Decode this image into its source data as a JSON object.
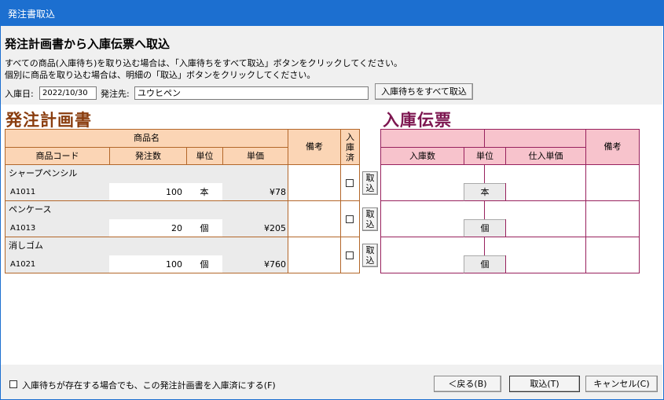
{
  "window": {
    "title": "発注書取込"
  },
  "heading": "発注計画書から入庫伝票へ取込",
  "instructions": [
    "すべての商品(入庫待ち)を取り込む場合は、「入庫待ちをすべて取込」ボタンをクリックしてください。",
    "個別に商品を取り込む場合は、明細の「取込」ボタンをクリックしてください。"
  ],
  "form": {
    "date_label": "入庫日:",
    "date_value": "2022/10/30",
    "supplier_label": "発注先:",
    "supplier_value": "ユウヒペン",
    "import_all_button": "入庫待ちをすべて取込"
  },
  "order_plan": {
    "title": "発注計画書",
    "headers": {
      "product_name": "商品名",
      "product_code": "商品コード",
      "order_qty": "発注数",
      "unit": "単位",
      "unit_price": "単価",
      "remarks": "備考",
      "received_line1": "入",
      "received_line2": "庫",
      "received_line3": "済"
    },
    "rows": [
      {
        "name": "シャープペンシル",
        "code": "A1011",
        "qty": "100",
        "unit": "本",
        "price": "¥78",
        "remarks": "",
        "received": false
      },
      {
        "name": "ペンケース",
        "code": "A1013",
        "qty": "20",
        "unit": "個",
        "price": "¥205",
        "remarks": "",
        "received": false
      },
      {
        "name": "消しゴム",
        "code": "A1021",
        "qty": "100",
        "unit": "個",
        "price": "¥760",
        "remarks": "",
        "received": false
      }
    ],
    "import_button_line1": "取",
    "import_button_line2": "込"
  },
  "receipt": {
    "title": "入庫伝票",
    "headers": {
      "receipt_qty": "入庫数",
      "unit": "単位",
      "purchase_price": "仕入単価",
      "remarks": "備考"
    },
    "rows": [
      {
        "unit": "本"
      },
      {
        "unit": "個"
      },
      {
        "unit": "個"
      }
    ]
  },
  "footer": {
    "complete_checkbox_label": "入庫待ちが存在する場合でも、この発注計画書を入庫済にする(F)",
    "back_button": "＜戻る(B)",
    "import_button": "取込(T)",
    "cancel_button": "キャンセル(C)"
  },
  "colors": {
    "titlebar": "#1c6fd0",
    "order_title": "#8a3d0e",
    "order_header_bg": "#fbd5b5",
    "order_border": "#b3672a",
    "receipt_title": "#7d1650",
    "receipt_header_bg": "#f7c3cc",
    "receipt_border": "#98215d"
  }
}
